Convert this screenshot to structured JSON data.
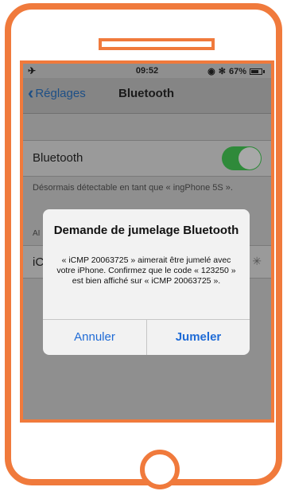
{
  "status_bar": {
    "time": "09:52",
    "battery": "67%",
    "airplane_icon": "airplane-icon",
    "icons": [
      "location-icon",
      "bluetooth-icon"
    ]
  },
  "nav": {
    "back_label": "Réglages",
    "title": "Bluetooth"
  },
  "bluetooth": {
    "label": "Bluetooth",
    "enabled": true,
    "discoverable_text": "Désormais détectable en tant que « ingPhone 5S »."
  },
  "devices": {
    "section_header": "AI",
    "first_device": "iC"
  },
  "alert": {
    "title": "Demande de jumelage Bluetooth",
    "message": "« iCMP 20063725 » aimerait être jumelé avec votre iPhone. Confirmez que le code « 123250 » est bien affiché sur « iCMP 20063725 ».",
    "cancel_label": "Annuler",
    "pair_label": "Jumeler"
  },
  "colors": {
    "frame": "#f07a3c",
    "link": "#1f6bd6",
    "toggle_on": "#2f8a3a"
  }
}
